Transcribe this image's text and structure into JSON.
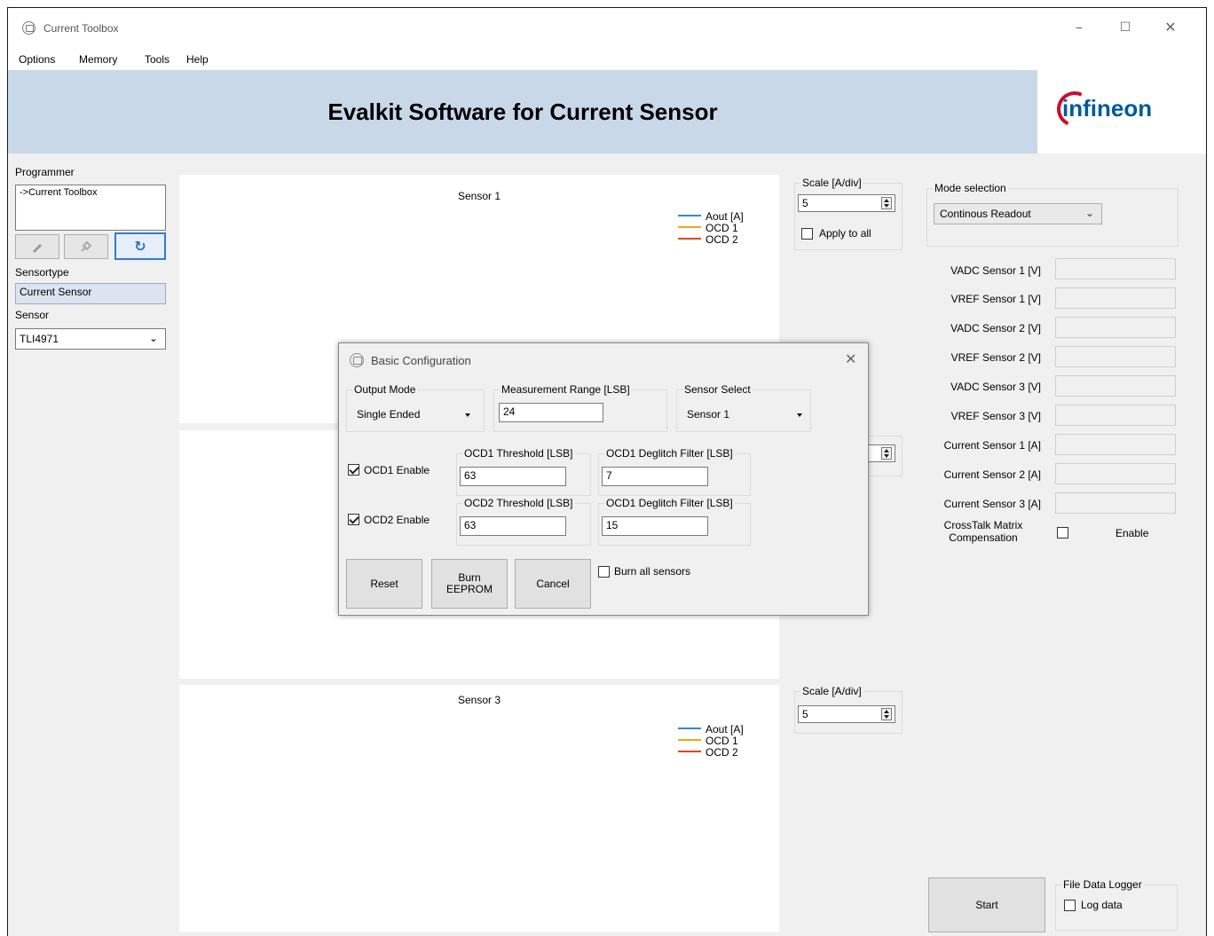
{
  "window": {
    "title": "Current Toolbox"
  },
  "menu": [
    "Options",
    "Memory",
    "Tools",
    "Help"
  ],
  "banner": {
    "title": "Evalkit Software for Current Sensor",
    "logo": "infineon"
  },
  "left": {
    "programmer_label": "Programmer",
    "programmer_value": "->Current Toolbox",
    "sensortype_label": "Sensortype",
    "sensortype_value": "Current Sensor",
    "sensor_label": "Sensor",
    "sensor_value": "TLI4971"
  },
  "charts": {
    "sensor1_title": "Sensor 1",
    "sensor3_title": "Sensor 3",
    "legend": [
      "Aout [A]",
      "OCD 1",
      "OCD 2"
    ],
    "legend_colors": [
      "#3b82d8",
      "#f3a51c",
      "#e0451f"
    ]
  },
  "scale": {
    "label": "Scale [A/div]",
    "value1": "5",
    "value3": "5",
    "apply_all": "Apply to all"
  },
  "right": {
    "mode_label": "Mode selection",
    "mode_value": "Continous Readout",
    "fields": [
      "VADC Sensor 1  [V]",
      "VREF Sensor 1 [V]",
      "VADC Sensor 2 [V]",
      "VREF Sensor 2 [V]",
      "VADC Sensor 3 [V]",
      "VREF Sensor 3 [V]",
      "Current Sensor 1 [A]",
      "Current Sensor 2 [A]",
      "Current Sensor 3 [A]"
    ],
    "crosstalk_label1": "CrossTalk Matrix",
    "crosstalk_label2": "Compensation",
    "enable_label": "Enable",
    "start": "Start",
    "logger_label": "File Data Logger",
    "log_label": "Log data"
  },
  "dialog": {
    "title": "Basic Configuration",
    "output_mode_label": "Output Mode",
    "output_mode_value": "Single Ended",
    "meas_range_label": "Measurement Range [LSB]",
    "meas_range_value": "24",
    "sensor_select_label": "Sensor Select",
    "sensor_select_value": "Sensor 1",
    "ocd1_enable": "OCD1 Enable",
    "ocd1_thr_label": "OCD1 Threshold [LSB]",
    "ocd1_thr_value": "63",
    "ocd1_flt_label": "OCD1 Deglitch Filter [LSB]",
    "ocd1_flt_value": "7",
    "ocd2_enable": "OCD2 Enable",
    "ocd2_thr_label": "OCD2 Threshold [LSB]",
    "ocd2_thr_value": "63",
    "ocd2_flt_label": "OCD1 Deglitch Filter [LSB]",
    "ocd2_flt_value": "15",
    "reset": "Reset",
    "burn1": "Burn",
    "burn2": "EEPROM",
    "cancel": "Cancel",
    "burn_all": "Burn all sensors"
  }
}
